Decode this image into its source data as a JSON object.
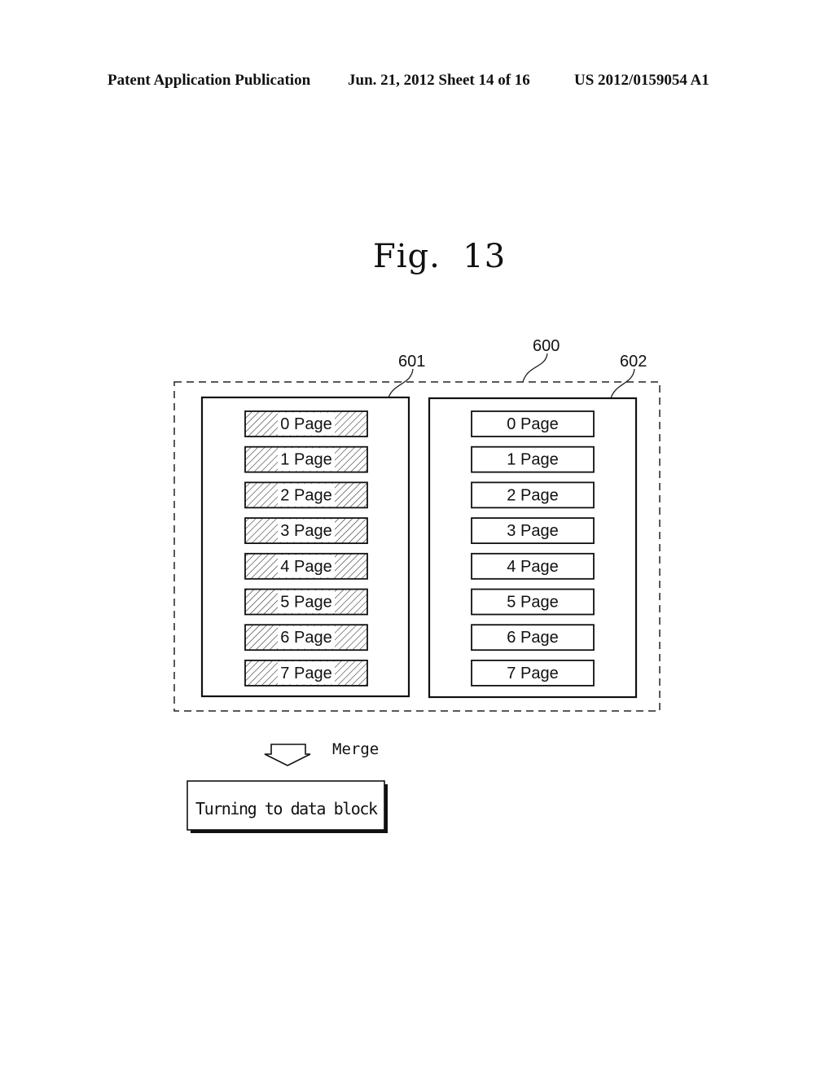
{
  "header": {
    "left": "Patent Application Publication",
    "middle": "Jun. 21, 2012  Sheet 14 of 16",
    "right": "US 2012/0159054 A1"
  },
  "figure": {
    "title": "Fig.  13",
    "labels": {
      "outer": "600",
      "left_block": "601",
      "right_block": "602"
    },
    "left_block": {
      "pages": [
        "0  Page",
        "1  Page",
        "2  Page",
        "3  Page",
        "4  Page",
        "5  Page",
        "6  Page",
        "7  Page"
      ],
      "style": "hatched"
    },
    "right_block": {
      "pages": [
        "0  Page",
        "1  Page",
        "2  Page",
        "3  Page",
        "4  Page",
        "5  Page",
        "6  Page",
        "7  Page"
      ],
      "style": "plain"
    },
    "arrow_label": "Merge",
    "result_box": "Turning to data block"
  },
  "colors": {
    "ink": "#111111",
    "paper": "#ffffff"
  }
}
